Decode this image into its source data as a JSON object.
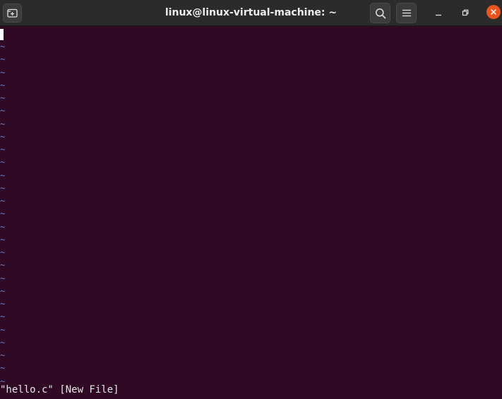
{
  "window": {
    "title": "linux@linux-virtual-machine: ~",
    "accent_close": "#e95420",
    "terminal_bg": "#300a24"
  },
  "toolbar": {
    "new_tab_icon": "new-tab-icon",
    "search_icon": "search-icon",
    "menu_icon": "hamburger-menu-icon",
    "minimize_icon": "minimize-icon",
    "maximize_icon": "restore-icon",
    "close_icon": "close-icon"
  },
  "editor": {
    "empty_line_marker": "~",
    "empty_line_count": 27,
    "status_message": "\"hello.c\" [New File]"
  }
}
